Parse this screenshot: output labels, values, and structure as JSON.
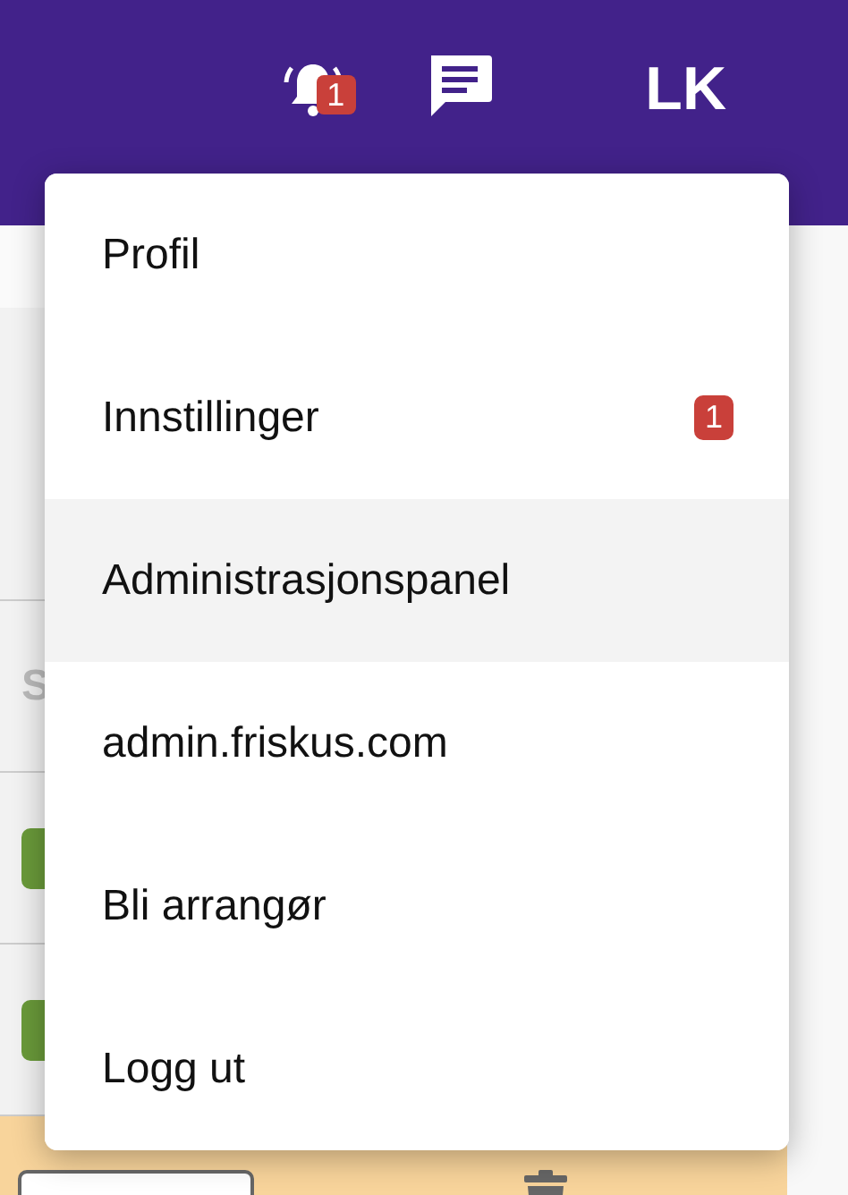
{
  "header": {
    "notifications": {
      "badge": "1"
    },
    "avatar": "LK"
  },
  "background": {
    "rows": [
      {
        "kind": "text",
        "text": "S"
      },
      {
        "kind": "tag"
      },
      {
        "kind": "tag"
      }
    ]
  },
  "menu": {
    "items": [
      {
        "label": "Profil",
        "selected": false
      },
      {
        "label": "Innstillinger",
        "selected": false,
        "badge": "1"
      },
      {
        "label": "Administrasjonspanel",
        "selected": true
      },
      {
        "label": "admin.friskus.com",
        "selected": false
      },
      {
        "label": "Bli arrangør",
        "selected": false
      },
      {
        "label": "Logg ut",
        "selected": false
      }
    ]
  }
}
